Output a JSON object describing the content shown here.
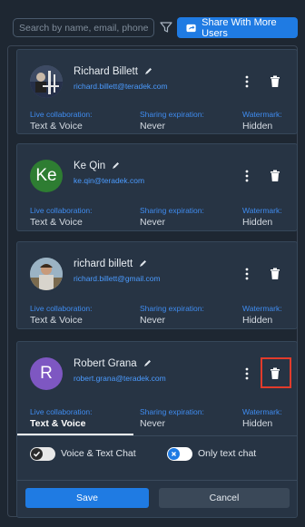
{
  "toolbar": {
    "search_placeholder": "Search by name, email, phone",
    "share_label": "Share With More Users",
    "filter_icon": "filter-icon",
    "share_icon": "share-icon"
  },
  "labels": {
    "live_collaboration": "Live collaboration:",
    "sharing_expiration": "Sharing expiration:",
    "watermark": "Watermark:"
  },
  "users": [
    {
      "name": "Richard Billett",
      "email": "richard.billett@teradek.com",
      "avatar": "photo",
      "collaboration": "Text & Voice",
      "expiration": "Never",
      "watermark": "Hidden"
    },
    {
      "name": "Ke Qin",
      "email": "ke.qin@teradek.com",
      "avatar": "Ke",
      "avatar_color": "#2e7d32",
      "collaboration": "Text & Voice",
      "expiration": "Never",
      "watermark": "Hidden"
    },
    {
      "name": "richard billett",
      "email": "richard.billett@gmail.com",
      "avatar": "photo",
      "collaboration": "Text & Voice",
      "expiration": "Never",
      "watermark": "Hidden"
    },
    {
      "name": "Robert Grana",
      "email": "robert.grana@teradek.com",
      "avatar": "R",
      "avatar_color": "#7e57c2",
      "collaboration": "Text & Voice",
      "expiration": "Never",
      "watermark": "Hidden"
    }
  ],
  "expanded_options": {
    "voice_text_label": "Voice & Text Chat",
    "only_text_label": "Only text chat",
    "voice_text_on": true,
    "only_text_on": false
  },
  "actions": {
    "save_label": "Save",
    "cancel_label": "Cancel"
  },
  "colors": {
    "accent": "#1f7be3",
    "highlight": "#e23b2b"
  }
}
